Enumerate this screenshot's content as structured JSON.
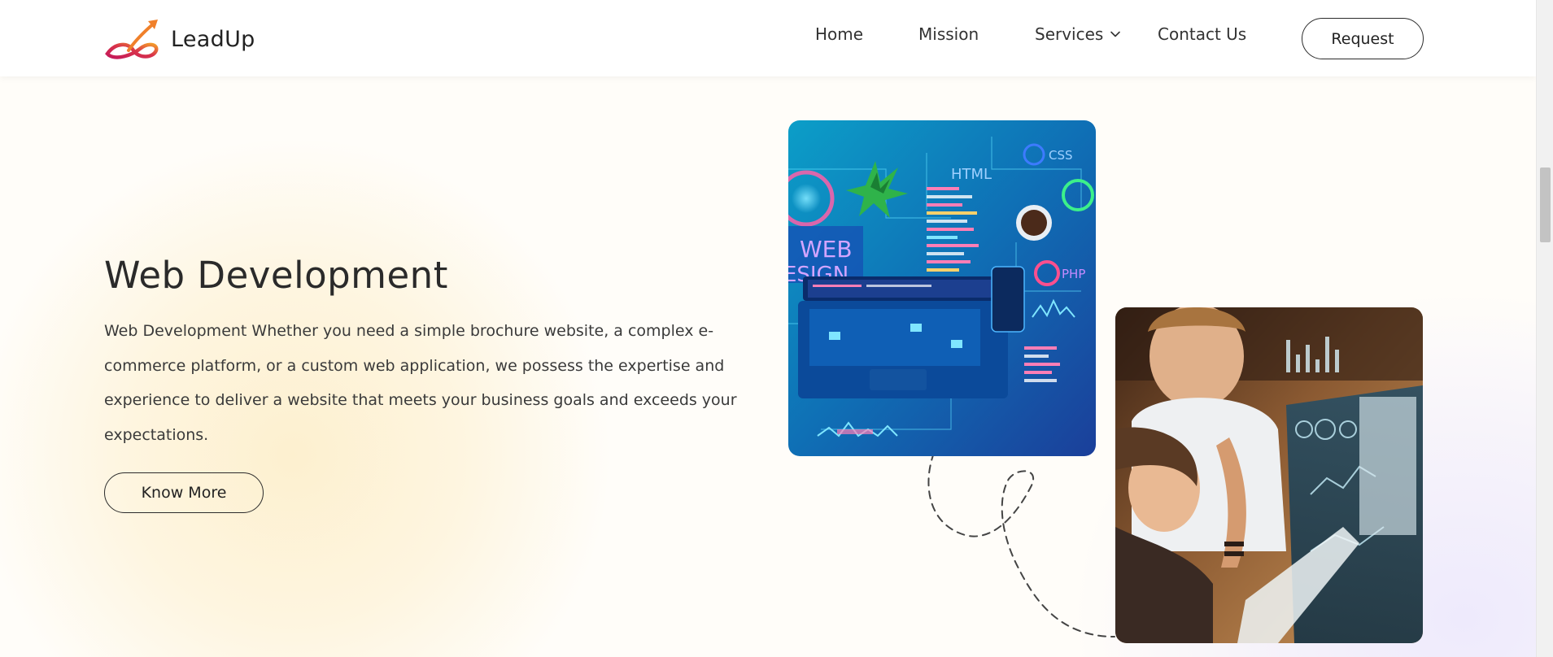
{
  "brand": {
    "name": "LeadUp",
    "logo_icon": "infinity-arrow-logo-icon"
  },
  "nav": {
    "items": [
      {
        "label": "Home"
      },
      {
        "label": "Mission"
      },
      {
        "label": "Services",
        "icon": "chevron-down-icon"
      },
      {
        "label": "Contact Us"
      }
    ],
    "request_label": "Request"
  },
  "hero": {
    "title": "Web Development",
    "description": "Web Development Whether you need a simple brochure website, a complex e-commerce platform, or a custom web application, we possess the expertise and experience to deliver a website that meets your business goals and exceeds your expectations.",
    "button_label": "Know More"
  },
  "images": {
    "web_dev_illustration": {
      "labels": [
        "HTML",
        "CSS",
        "PHP",
        "WEB",
        "ESIGN"
      ]
    },
    "team_photo": {}
  },
  "colors": {
    "accent_orange": "#f0802a",
    "accent_magenta": "#c4195a",
    "text": "#2b2b2b"
  }
}
